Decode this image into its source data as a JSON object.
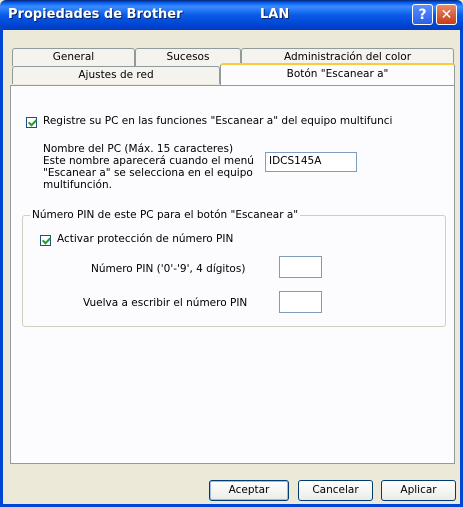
{
  "window": {
    "title": "Propiedades de Brother",
    "title_suffix": "LAN",
    "help_glyph": "?",
    "close_glyph": "✕"
  },
  "tabs": [
    {
      "label": "General"
    },
    {
      "label": "Sucesos"
    },
    {
      "label": "Administración del color"
    },
    {
      "label": "Ajustes de red"
    },
    {
      "label": "Botón \"Escanear a\"",
      "active": true
    }
  ],
  "register": {
    "label": "Registre su PC en las funciones \"Escanear a\" del equipo multifunci",
    "checked": true
  },
  "pc_name": {
    "line1": "Nombre del PC (Máx. 15 caracteres)",
    "line2": "Este nombre aparecerá cuando el menú",
    "line3": "\"Escanear a\" se selecciona en el equipo",
    "line4": "multifunción.",
    "value": "IDCS145A"
  },
  "pin_group": {
    "legend": "Número PIN de este PC para el botón \"Escanear a\"",
    "activate_label": "Activar protección de número PIN",
    "activate_checked": true,
    "pin_label": "Número PIN ('0'-'9', 4 dígitos)",
    "pin_value": "",
    "repeat_label": "Vuelva a escribir el número PIN",
    "repeat_value": ""
  },
  "buttons": {
    "ok": "Aceptar",
    "cancel": "Cancelar",
    "apply": "Aplicar"
  }
}
